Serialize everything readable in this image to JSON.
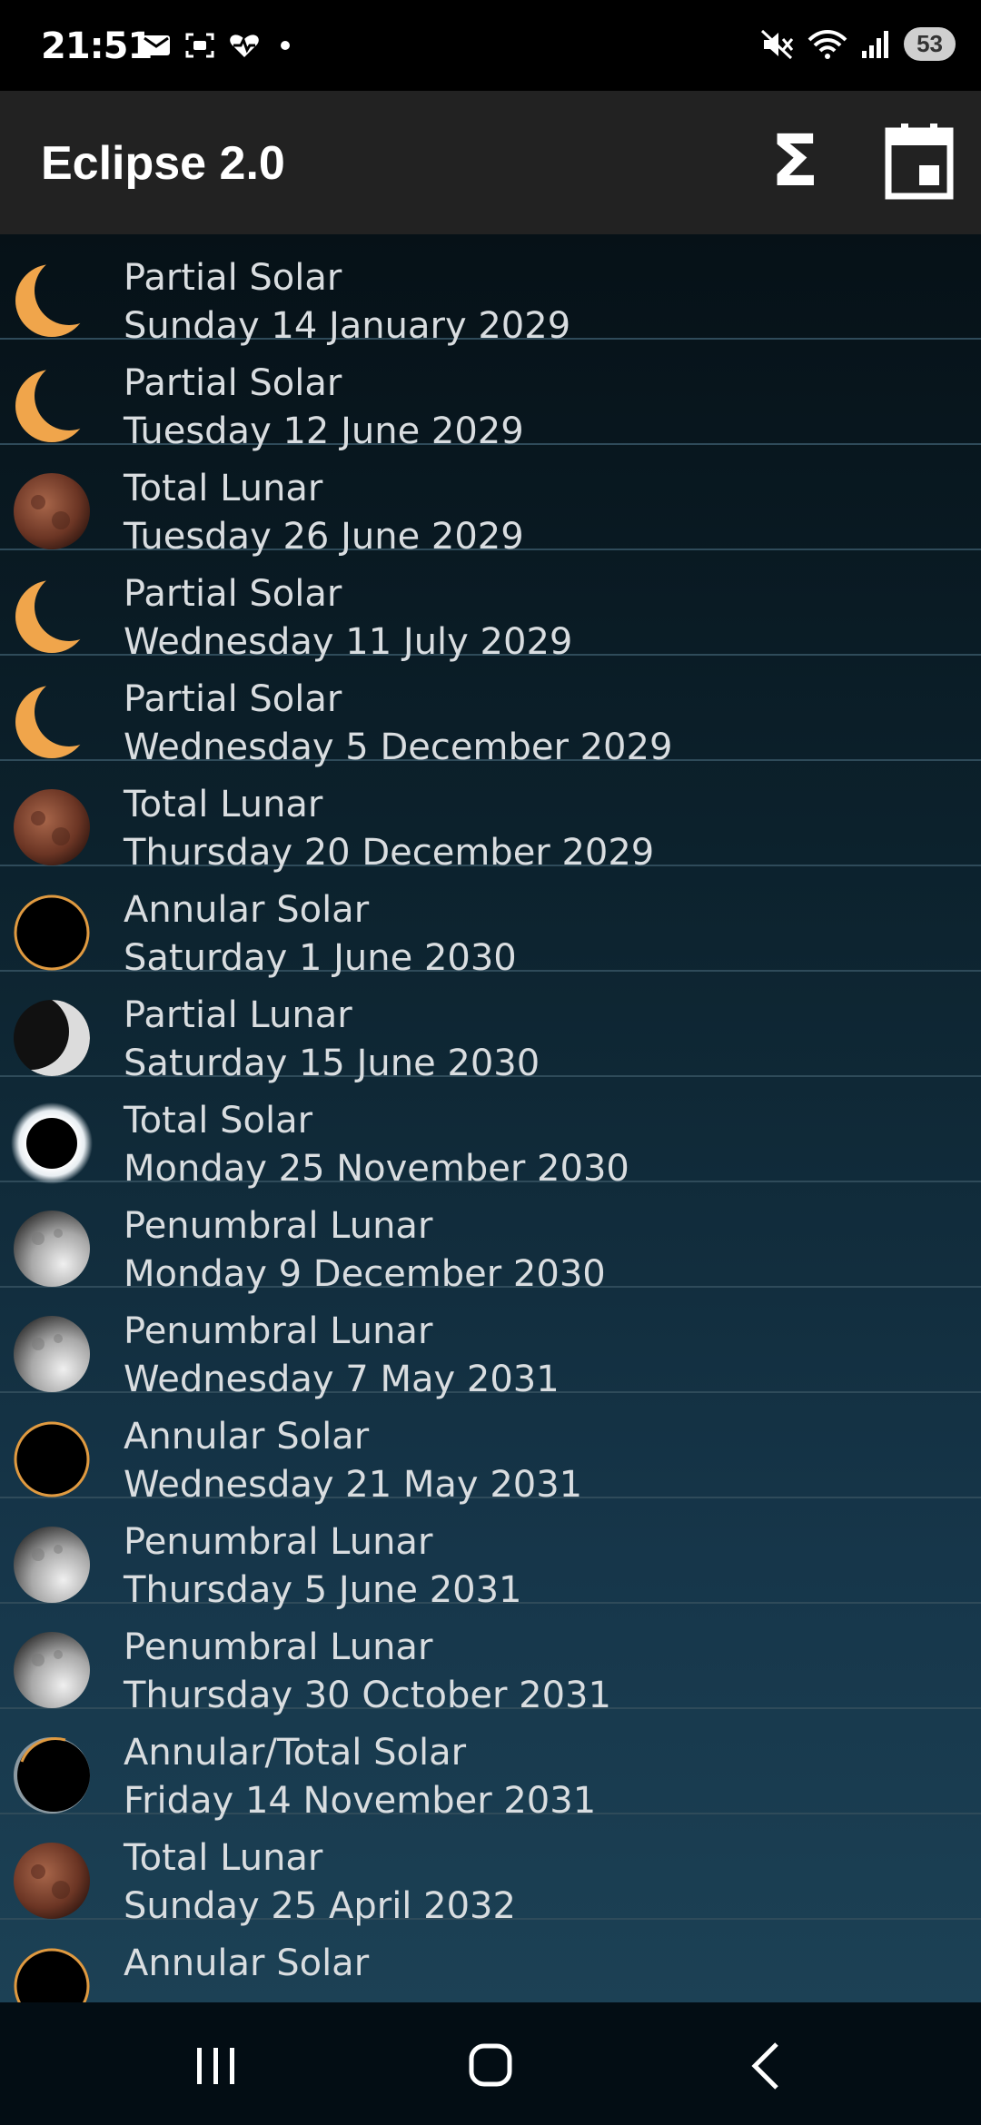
{
  "status_bar": {
    "time": "21:51",
    "battery": "53"
  },
  "app_bar": {
    "title": "Eclipse 2.0",
    "sigma_label": "Σ"
  },
  "eclipses": [
    {
      "type": "Partial Solar",
      "date": "Sunday 14 January 2029",
      "icon": "partial-solar-icon"
    },
    {
      "type": "Partial Solar",
      "date": "Tuesday 12 June 2029",
      "icon": "partial-solar-icon"
    },
    {
      "type": "Total Lunar",
      "date": "Tuesday 26 June 2029",
      "icon": "total-lunar-icon"
    },
    {
      "type": "Partial Solar",
      "date": "Wednesday 11 July 2029",
      "icon": "partial-solar-icon"
    },
    {
      "type": "Partial Solar",
      "date": "Wednesday 5 December 2029",
      "icon": "partial-solar-icon"
    },
    {
      "type": "Total Lunar",
      "date": "Thursday 20 December 2029",
      "icon": "total-lunar-icon"
    },
    {
      "type": "Annular Solar",
      "date": "Saturday 1 June 2030",
      "icon": "annular-solar-icon"
    },
    {
      "type": "Partial Lunar",
      "date": "Saturday 15 June 2030",
      "icon": "partial-lunar-icon"
    },
    {
      "type": "Total Solar",
      "date": "Monday 25 November 2030",
      "icon": "total-solar-icon"
    },
    {
      "type": "Penumbral Lunar",
      "date": "Monday 9 December 2030",
      "icon": "penumbral-lunar-icon"
    },
    {
      "type": "Penumbral Lunar",
      "date": "Wednesday 7 May 2031",
      "icon": "penumbral-lunar-icon"
    },
    {
      "type": "Annular Solar",
      "date": "Wednesday 21 May 2031",
      "icon": "annular-solar-icon"
    },
    {
      "type": "Penumbral Lunar",
      "date": "Thursday 5 June 2031",
      "icon": "penumbral-lunar-icon"
    },
    {
      "type": "Penumbral Lunar",
      "date": "Thursday 30 October 2031",
      "icon": "penumbral-lunar-icon"
    },
    {
      "type": "Annular/Total Solar",
      "date": "Friday 14 November 2031",
      "icon": "hybrid-solar-icon"
    },
    {
      "type": "Total Lunar",
      "date": "Sunday 25 April 2032",
      "icon": "total-lunar-icon"
    },
    {
      "type": "Annular Solar",
      "date": "",
      "icon": "annular-solar-icon"
    }
  ]
}
